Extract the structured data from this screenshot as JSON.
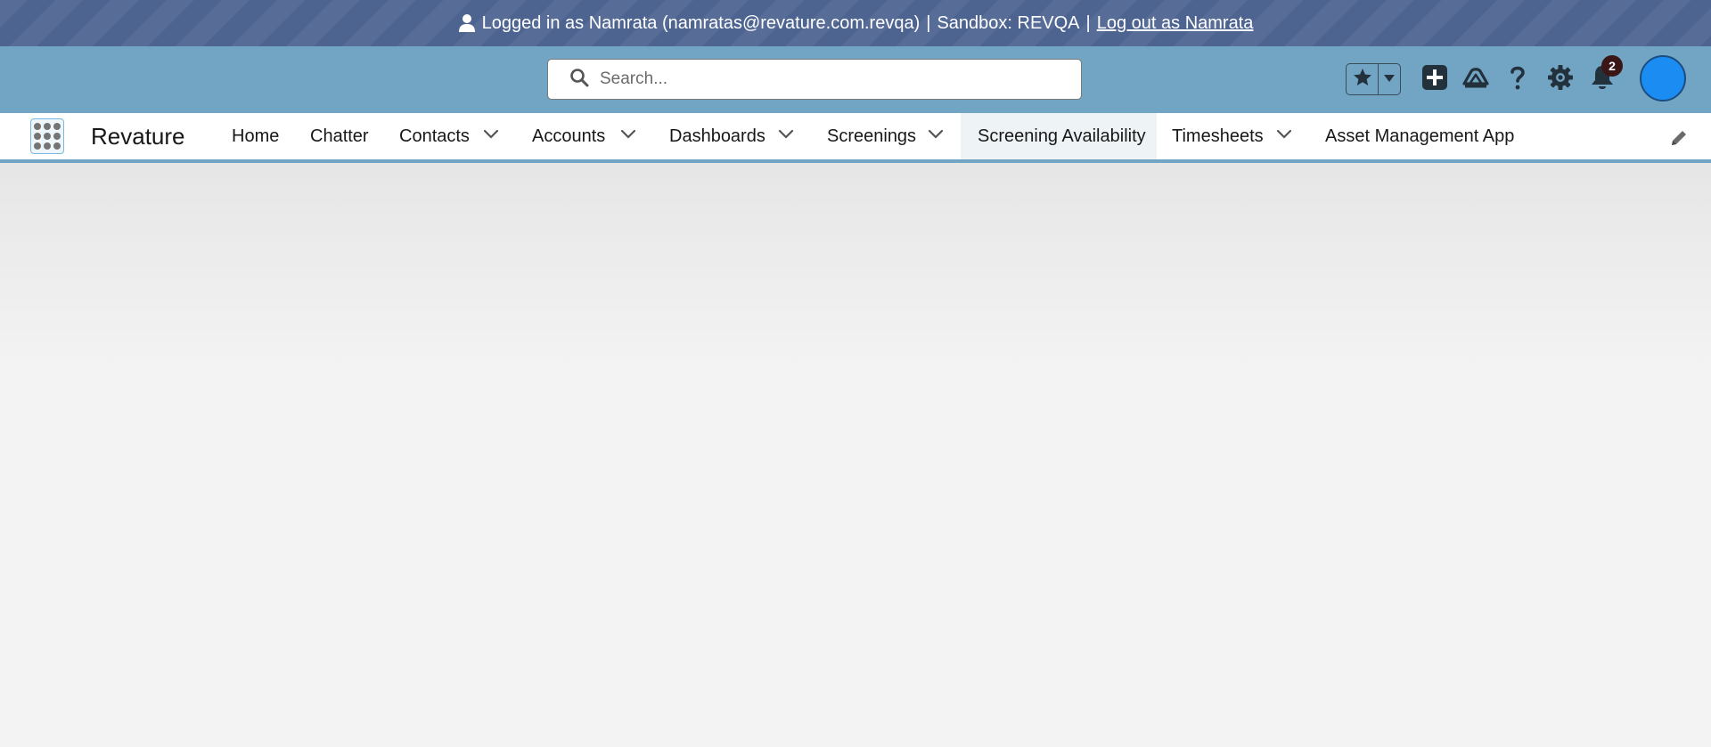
{
  "banner": {
    "icon": "user-icon",
    "logged_in_text": "Logged in as Namrata (namratas@revature.com.revqa)",
    "separator": "|",
    "sandbox_text": "Sandbox: REVQA",
    "logout_link": "Log out as Namrata"
  },
  "header": {
    "search": {
      "placeholder": "Search...",
      "value": "",
      "icon": "search-icon"
    },
    "icons": [
      "star-icon",
      "chevron-down-icon",
      "plus-icon",
      "trailhead-icon",
      "help-icon",
      "gear-icon",
      "bell-icon"
    ],
    "notification_count": "2"
  },
  "nav": {
    "app_name": "Revature",
    "items": [
      {
        "label": "Home",
        "has_menu": false
      },
      {
        "label": "Chatter",
        "has_menu": false
      },
      {
        "label": "Contacts",
        "has_menu": true
      },
      {
        "label": "Accounts",
        "has_menu": true
      },
      {
        "label": "Dashboards",
        "has_menu": true
      },
      {
        "label": "Screenings",
        "has_menu": true
      },
      {
        "label": "Screening Availability",
        "has_menu": false,
        "active": true
      },
      {
        "label": "Timesheets",
        "has_menu": true
      },
      {
        "label": "Asset Management App",
        "has_menu": false
      }
    ]
  },
  "colors": {
    "banner": "#4d6390",
    "header": "#72a4c3",
    "avatar": "#1b8cf2",
    "badge": "#3b1616"
  }
}
